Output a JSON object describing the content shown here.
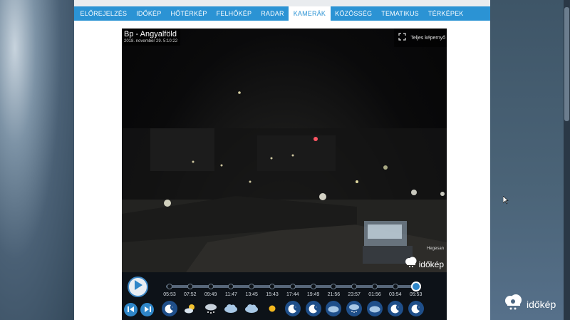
{
  "nav": {
    "items": [
      {
        "label": "ELŐREJELZÉS",
        "active": false
      },
      {
        "label": "IDŐKÉP",
        "active": false
      },
      {
        "label": "HŐTÉRKÉP",
        "active": false
      },
      {
        "label": "FELHŐKÉP",
        "active": false
      },
      {
        "label": "RADAR",
        "active": false
      },
      {
        "label": "KAMERÁK",
        "active": true
      },
      {
        "label": "KÖZÖSSÉG",
        "active": false
      },
      {
        "label": "TEMATIKUS",
        "active": false
      },
      {
        "label": "TÉRKÉPEK",
        "active": false
      }
    ]
  },
  "camera": {
    "name": "Bp - Angyalföld",
    "datetime": "2018. november 29. 5:10:22",
    "fullscreen_label": "Teljes képernyő",
    "credit": "Hegesan",
    "watermark": "időkép"
  },
  "timeline": {
    "times": [
      "05:53",
      "07:52",
      "09:49",
      "11:47",
      "13:45",
      "15:43",
      "17:44",
      "19:49",
      "21:56",
      "23:57",
      "01:56",
      "03:54",
      "05:53"
    ],
    "current_index": 12,
    "weather": [
      "clear-night-icon",
      "partly-cloudy-day-icon",
      "snow-cloud-icon",
      "cloudy-icon",
      "cloudy-icon",
      "sunny-icon",
      "clear-night-icon",
      "clear-night-icon",
      "cloudy-night-icon",
      "snow-night-icon",
      "cloudy-night-icon",
      "clear-night-icon",
      "clear-night-icon"
    ]
  },
  "brand": {
    "logo_text": "időkép"
  },
  "colors": {
    "accent": "#2b93d4",
    "night_icon_bg": "#1f4f8a"
  }
}
